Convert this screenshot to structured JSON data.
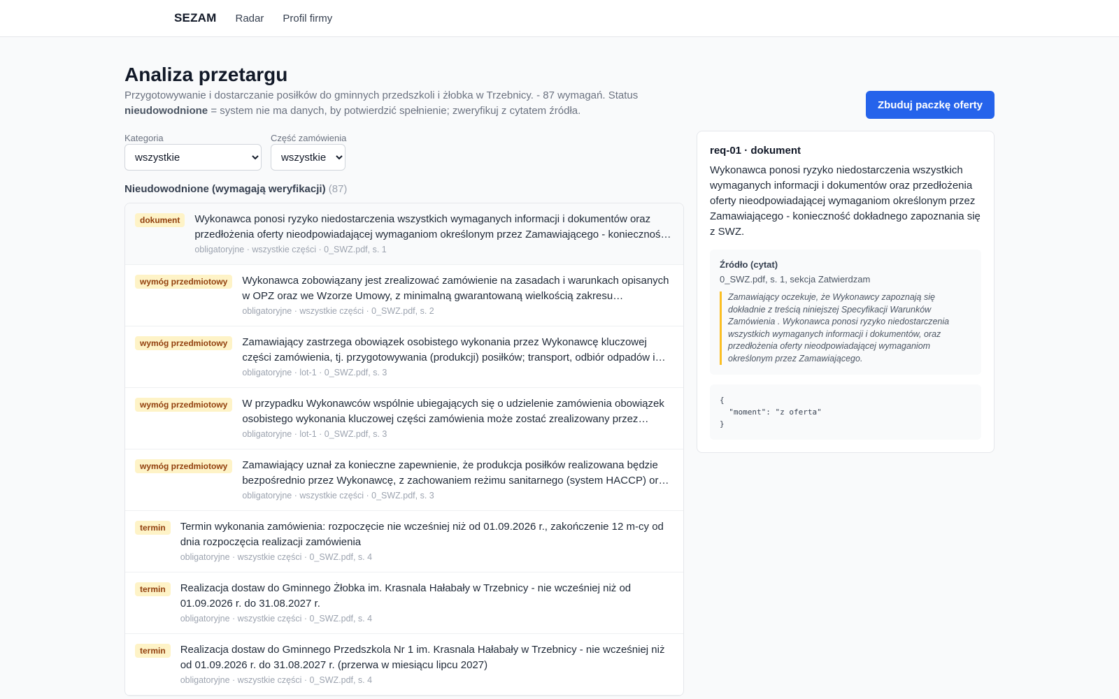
{
  "nav": {
    "brand": "SEZAM",
    "links": [
      "Radar",
      "Profil firmy"
    ]
  },
  "header": {
    "title": "Analiza przetargu",
    "desc_part1": "Przygotowywanie i dostarczanie posiłków do gminnych przedszkoli i żłobka w Trzebnicy. - 87 wymagań. Status ",
    "desc_bold": "nieudowodnione",
    "desc_part2": " = system nie ma danych, by potwierdzić spełnienie; zweryfikuj z cytatem źródła.",
    "build_button": "Zbuduj paczkę oferty"
  },
  "filters": {
    "category": {
      "label": "Kategoria",
      "value": "wszystkie"
    },
    "part": {
      "label": "Część zamówienia",
      "value": "wszystkie"
    }
  },
  "section": {
    "title": "Nieudowodnione (wymagają weryfikacji)",
    "count": "(87)"
  },
  "requirements": [
    {
      "badge": "dokument",
      "text": "Wykonawca ponosi ryzyko niedostarczenia wszystkich wymaganych informacji i dokumentów oraz przedłożenia oferty nieodpowiadającej wymaganiom określonym przez Zamawiającego - konieczność dokładnego zapoznania się z SWZ.",
      "meta": "obligatoryjne · wszystkie części · 0_SWZ.pdf, s. 1"
    },
    {
      "badge": "wymóg przedmiotowy",
      "text": "Wykonawca zobowiązany jest zrealizować zamówienie na zasadach i warunkach opisanych w OPZ oraz we Wzorze Umowy, z minimalną gwarantowaną wielkością zakresu zamówienia.",
      "meta": "obligatoryjne · wszystkie części · 0_SWZ.pdf, s. 2"
    },
    {
      "badge": "wymóg przedmiotowy",
      "text": "Zamawiający zastrzega obowiązek osobistego wykonania przez Wykonawcę kluczowej części zamówienia, tj. przygotowywania (produkcji) posiłków; transport, odbiór odpadów i inne czynności.",
      "meta": "obligatoryjne · lot-1 · 0_SWZ.pdf, s. 3"
    },
    {
      "badge": "wymóg przedmiotowy",
      "text": "W przypadku Wykonawców wspólnie ubiegających się o udzielenie zamówienia obowiązek osobistego wykonania kluczowej części zamówienia może zostać zrealizowany przez jednego z nich.",
      "meta": "obligatoryjne · lot-1 · 0_SWZ.pdf, s. 3"
    },
    {
      "badge": "wymóg przedmiotowy",
      "text": "Zamawiający uznał za konieczne zapewnienie, że produkcja posiłków realizowana będzie bezpośrednio przez Wykonawcę, z zachowaniem reżimu sanitarnego (system HACCP) oraz norm żywienia.",
      "meta": "obligatoryjne · wszystkie części · 0_SWZ.pdf, s. 3"
    },
    {
      "badge": "termin",
      "text": "Termin wykonania zamówienia: rozpoczęcie nie wcześniej niż od 01.09.2026 r., zakończenie 12 m-cy od dnia rozpoczęcia realizacji zamówienia",
      "meta": "obligatoryjne · wszystkie części · 0_SWZ.pdf, s. 4"
    },
    {
      "badge": "termin",
      "text": "Realizacja dostaw do Gminnego Żłobka im. Krasnala Hałabały w Trzebnicy - nie wcześniej niż od 01.09.2026 r. do 31.08.2027 r.",
      "meta": "obligatoryjne · wszystkie części · 0_SWZ.pdf, s. 4"
    },
    {
      "badge": "termin",
      "text": "Realizacja dostaw do Gminnego Przedszkola Nr 1 im. Krasnala Hałabały w Trzebnicy - nie wcześniej niż od 01.09.2026 r. do 31.08.2027 r. (przerwa w miesiącu lipcu 2027)",
      "meta": "obligatoryjne · wszystkie części · 0_SWZ.pdf, s. 4"
    }
  ],
  "detail": {
    "id": "req-01 · dokument",
    "text": "Wykonawca ponosi ryzyko niedostarczenia wszystkich wymaganych informacji i dokumentów oraz przedłożenia oferty nieodpowiadającej wymaganiom określonym przez Zamawiającego - konieczność dokładnego zapoznania się z SWZ.",
    "source_title": "Źródło (cytat)",
    "source_ref": "0_SWZ.pdf, s. 1, sekcja Zatwierdzam",
    "source_quote": "Zamawiający oczekuje, że Wykonawcy zapoznają się dokładnie z treścią niniejszej Specyfikacji Warunków Zamówienia . Wykonawca ponosi ryzyko niedostarczenia wszystkich wymaganych informacji i dokumentów, oraz przedłożenia oferty nieodpowiadającej wymaganiom określonym przez Zamawiającego.",
    "json": "{\n  \"moment\": \"z oferta\"\n}"
  }
}
